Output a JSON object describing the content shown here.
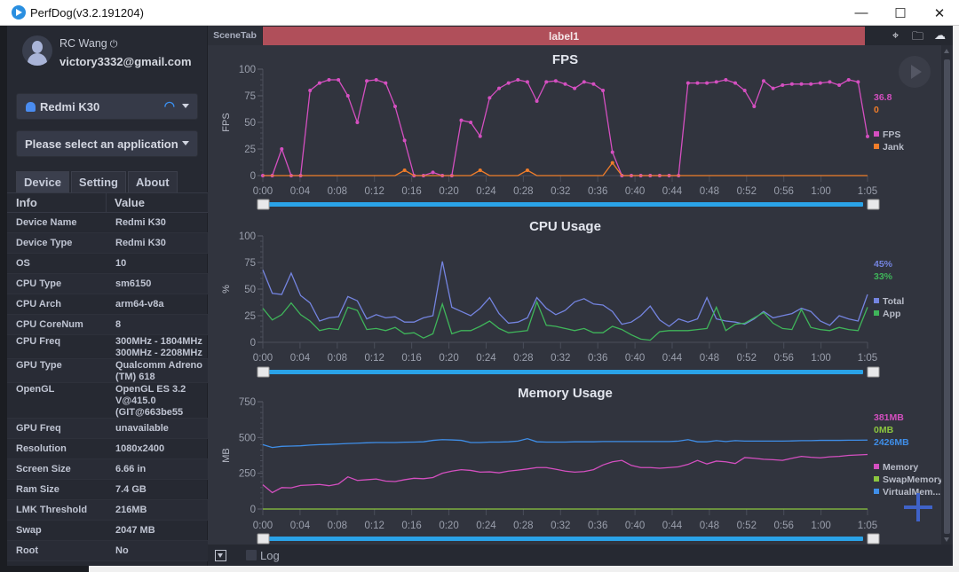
{
  "window": {
    "title": "PerfDog(v3.2.191204)",
    "controls": [
      "minimize",
      "maximize",
      "close"
    ]
  },
  "user": {
    "name": "RC Wang",
    "email": "victory3332@gmail.com"
  },
  "device_select": {
    "value": "Redmi K30",
    "icon": "android-icon",
    "connection_icon": "wifi-icon"
  },
  "app_select": {
    "placeholder": "Please select an application"
  },
  "tabs": [
    {
      "label": "Device",
      "active": true
    },
    {
      "label": "Setting",
      "active": false
    },
    {
      "label": "About",
      "active": false
    }
  ],
  "info_table": {
    "headers": [
      "Info",
      "Value"
    ],
    "rows": [
      {
        "key": "Device Name",
        "value": "Redmi K30"
      },
      {
        "key": "Device Type",
        "value": "Redmi K30"
      },
      {
        "key": "OS",
        "value": "10"
      },
      {
        "key": "CPU Type",
        "value": "sm6150"
      },
      {
        "key": "CPU Arch",
        "value": "arm64-v8a"
      },
      {
        "key": "CPU CoreNum",
        "value": "8"
      },
      {
        "key": "CPU Freq",
        "value": "300MHz - 1804MHz\n300MHz - 2208MHz"
      },
      {
        "key": "GPU Type",
        "value": "Qualcomm Adreno\n(TM) 618"
      },
      {
        "key": "OpenGL",
        "value": "OpenGL ES 3.2\nV@415.0\n(GIT@663be55"
      },
      {
        "key": "GPU Freq",
        "value": "unavailable"
      },
      {
        "key": "Resolution",
        "value": "1080x2400"
      },
      {
        "key": "Screen Size",
        "value": "6.66 in"
      },
      {
        "key": "Ram Size",
        "value": "7.4 GB"
      },
      {
        "key": "LMK Threshold",
        "value": "216MB"
      },
      {
        "key": "Swap",
        "value": "2047 MB"
      },
      {
        "key": "Root",
        "value": "No"
      }
    ]
  },
  "scene": {
    "tab_label": "SceneTab",
    "label": "label1",
    "icons": [
      "location-icon",
      "folder-icon",
      "cloud-icon"
    ]
  },
  "bottom": {
    "log_label": "Log",
    "log_checked": false
  },
  "chart_data": [
    {
      "type": "line",
      "title": "FPS",
      "ylabel": "FPS",
      "xlabel": "",
      "ylim": [
        0,
        100
      ],
      "yticks": [
        0,
        25,
        50,
        75,
        100
      ],
      "xticks": [
        "0:00",
        "0:04",
        "0:08",
        "0:12",
        "0:16",
        "0:20",
        "0:24",
        "0:28",
        "0:32",
        "0:36",
        "0:40",
        "0:44",
        "0:48",
        "0:52",
        "0:56",
        "1:00",
        "1:05"
      ],
      "x_range_seconds": [
        0,
        65
      ],
      "legend_position": "right",
      "series": [
        {
          "name": "FPS",
          "color": "#d44fc0",
          "current": "36.8",
          "markers": true,
          "values": [
            0,
            0,
            25,
            0,
            0,
            80,
            87,
            90,
            90,
            75,
            50,
            89,
            90,
            87,
            65,
            33,
            0,
            0,
            3,
            0,
            0,
            52,
            50,
            37,
            73,
            82,
            87,
            90,
            88,
            70,
            88,
            89,
            86,
            82,
            88,
            86,
            80,
            22,
            0,
            0,
            0,
            0,
            0,
            0,
            0,
            87,
            87,
            87,
            88,
            90,
            87,
            80,
            65,
            89,
            82,
            85,
            86,
            86,
            86,
            87,
            88,
            85,
            90,
            88,
            36.8
          ]
        },
        {
          "name": "Jank",
          "color": "#f07d2a",
          "current": "0",
          "markers": false,
          "values": [
            0,
            0,
            0,
            0,
            0,
            0,
            0,
            0,
            0,
            0,
            0,
            0,
            0,
            0,
            0,
            5,
            0,
            0,
            0,
            0,
            0,
            0,
            0,
            5,
            0,
            0,
            0,
            0,
            5,
            0,
            0,
            0,
            0,
            0,
            0,
            0,
            0,
            12,
            0,
            0,
            0,
            0,
            0,
            0,
            0,
            0,
            0,
            0,
            0,
            0,
            0,
            0,
            0,
            0,
            0,
            0,
            0,
            0,
            0,
            0,
            0,
            0,
            0,
            0,
            0
          ]
        }
      ]
    },
    {
      "type": "line",
      "title": "CPU Usage",
      "ylabel": "%",
      "xlabel": "",
      "ylim": [
        0,
        100
      ],
      "yticks": [
        0,
        25,
        50,
        75,
        100
      ],
      "xticks": [
        "0:00",
        "0:04",
        "0:08",
        "0:12",
        "0:16",
        "0:20",
        "0:24",
        "0:28",
        "0:32",
        "0:36",
        "0:40",
        "0:44",
        "0:48",
        "0:52",
        "0:56",
        "1:00",
        "1:05"
      ],
      "x_range_seconds": [
        0,
        65
      ],
      "legend_position": "right",
      "series": [
        {
          "name": "Total",
          "color": "#7484e0",
          "current": "45%",
          "values": [
            68,
            46,
            45,
            65,
            44,
            37,
            20,
            23,
            24,
            43,
            39,
            22,
            26,
            23,
            24,
            19,
            19,
            23,
            25,
            76,
            33,
            29,
            25,
            32,
            42,
            27,
            18,
            19,
            23,
            42,
            32,
            26,
            30,
            38,
            41,
            36,
            35,
            29,
            17,
            19,
            25,
            34,
            21,
            15,
            22,
            19,
            22,
            42,
            22,
            20,
            19,
            17,
            22,
            29,
            23,
            25,
            27,
            32,
            29,
            20,
            16,
            25,
            22,
            20,
            45
          ]
        },
        {
          "name": "App",
          "color": "#3fb55a",
          "current": "33%",
          "values": [
            32,
            21,
            26,
            37,
            26,
            20,
            11,
            13,
            12,
            33,
            30,
            12,
            13,
            11,
            14,
            8,
            9,
            4,
            8,
            36,
            8,
            11,
            11,
            15,
            20,
            13,
            9,
            10,
            11,
            38,
            16,
            15,
            13,
            11,
            13,
            9,
            9,
            15,
            12,
            7,
            3,
            2,
            10,
            11,
            11,
            11,
            12,
            13,
            33,
            11,
            17,
            18,
            23,
            28,
            18,
            13,
            12,
            31,
            14,
            12,
            11,
            14,
            12,
            11,
            33
          ]
        }
      ]
    },
    {
      "type": "line",
      "title": "Memory Usage",
      "ylabel": "MB",
      "xlabel": "",
      "ylim": [
        0,
        750
      ],
      "yticks": [
        0,
        250,
        500,
        750
      ],
      "xticks": [
        "0:00",
        "0:04",
        "0:08",
        "0:12",
        "0:16",
        "0:20",
        "0:24",
        "0:28",
        "0:32",
        "0:36",
        "0:40",
        "0:44",
        "0:48",
        "0:52",
        "0:56",
        "1:00",
        "1:05"
      ],
      "x_range_seconds": [
        0,
        65
      ],
      "legend_position": "right",
      "series": [
        {
          "name": "Memory",
          "color": "#d44fc0",
          "current": "381MB",
          "values": [
            170,
            115,
            150,
            148,
            165,
            168,
            172,
            163,
            175,
            225,
            200,
            205,
            210,
            195,
            192,
            205,
            215,
            212,
            220,
            250,
            265,
            275,
            270,
            258,
            260,
            253,
            265,
            272,
            280,
            290,
            290,
            278,
            265,
            258,
            262,
            275,
            308,
            330,
            340,
            305,
            290,
            290,
            285,
            290,
            295,
            312,
            340,
            315,
            335,
            330,
            318,
            360,
            355,
            348,
            345,
            340,
            355,
            368,
            362,
            358,
            365,
            368,
            375,
            378,
            381
          ]
        },
        {
          "name": "SwapMemory",
          "color": "#8cc63f",
          "current": "0MB",
          "values": [
            0,
            0,
            0,
            0,
            0,
            0,
            0,
            0,
            0,
            0,
            0,
            0,
            0,
            0,
            0,
            0,
            0,
            0,
            0,
            0,
            0,
            0,
            0,
            0,
            0,
            0,
            0,
            0,
            0,
            0,
            0,
            0,
            0,
            0,
            0,
            0,
            0,
            0,
            0,
            0,
            0,
            0,
            0,
            0,
            0,
            0,
            0,
            0,
            0,
            0,
            0,
            0,
            0,
            0,
            0,
            0,
            0,
            0,
            0,
            0,
            0,
            0,
            0,
            0,
            0
          ]
        },
        {
          "name": "VirtualMemory",
          "display_name": "VirtualMem...",
          "color": "#3f8ee8",
          "current": "2426MB",
          "values": [
            450,
            430,
            438,
            440,
            442,
            447,
            450,
            452,
            455,
            458,
            460,
            463,
            465,
            465,
            465,
            467,
            468,
            470,
            480,
            485,
            483,
            480,
            465,
            465,
            468,
            468,
            470,
            475,
            492,
            470,
            468,
            468,
            468,
            470,
            470,
            470,
            472,
            472,
            472,
            472,
            472,
            472,
            472,
            472,
            475,
            485,
            470,
            470,
            478,
            472,
            478,
            475,
            475,
            475,
            475,
            475,
            476,
            478,
            478,
            480,
            480,
            480,
            481,
            481,
            482
          ]
        }
      ]
    }
  ]
}
